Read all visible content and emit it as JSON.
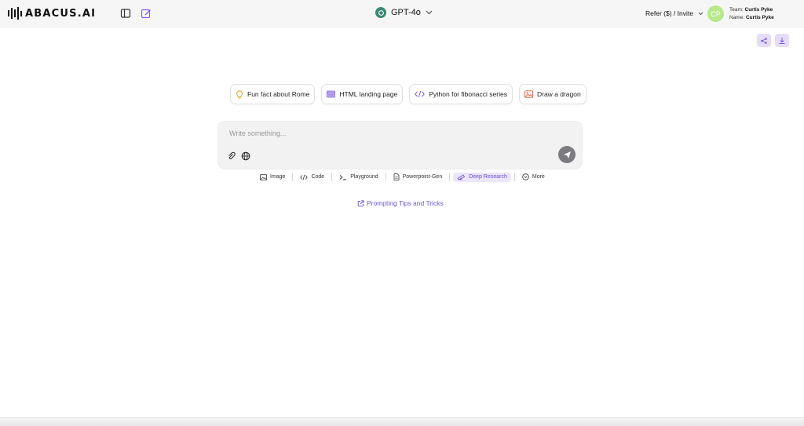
{
  "header": {
    "logo_text": "ABACUS.AI",
    "model": "GPT-4o",
    "refer_label": "Refer ($) / Invite",
    "avatar_initials": "CP",
    "team_label": "Team:",
    "team_value": "Curtis Pyke",
    "name_label": "Name:",
    "name_value": "Curtis Pyke"
  },
  "suggestions": [
    {
      "label": "Fun fact about Rome",
      "icon": "lightbulb-icon"
    },
    {
      "label": "HTML landing page",
      "icon": "webpage-icon"
    },
    {
      "label": "Python for fibonacci series",
      "icon": "code-icon"
    },
    {
      "label": "Draw a dragon",
      "icon": "image-icon"
    }
  ],
  "composer": {
    "placeholder": "Write something..."
  },
  "tools": [
    {
      "label": "Image",
      "icon": "image-icon"
    },
    {
      "label": "Code",
      "icon": "code-icon"
    },
    {
      "label": "Playground",
      "icon": "terminal-icon"
    },
    {
      "label": "Powerpoint-Gen",
      "icon": "document-icon"
    },
    {
      "label": "Deep Research",
      "icon": "telescope-icon"
    },
    {
      "label": "More",
      "icon": "chevron-circle-icon"
    }
  ],
  "tips_link": "Prompting Tips and Tricks",
  "colors": {
    "accent": "#6f53d9",
    "avatar": "#b7e88a",
    "model_badge": "#3a8a74"
  }
}
